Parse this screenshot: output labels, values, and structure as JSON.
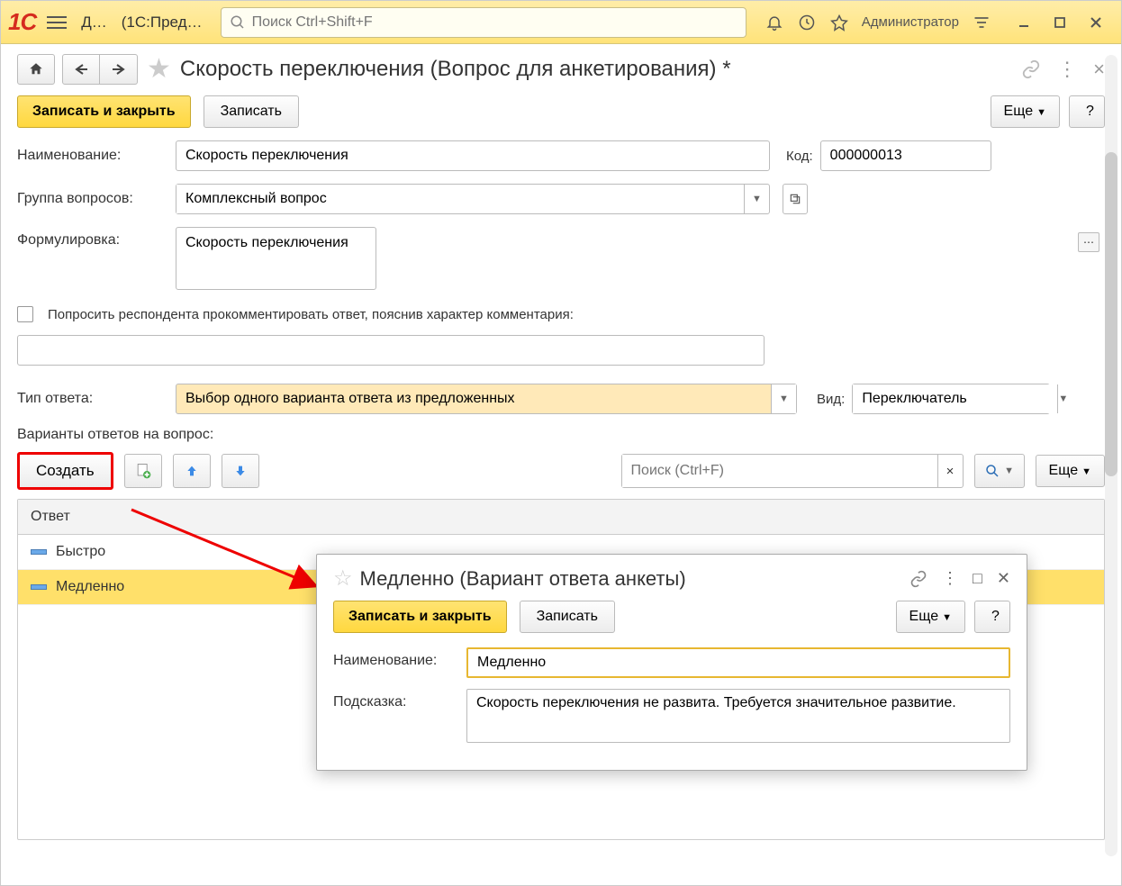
{
  "topbar": {
    "app_short": "Д…",
    "app_paren": "(1С:Пред…",
    "search_placeholder": "Поиск Ctrl+Shift+F",
    "user": "Администратор"
  },
  "page": {
    "title": "Скорость переключения (Вопрос для анкетирования) *"
  },
  "cmd": {
    "save_close": "Записать и закрыть",
    "save": "Записать",
    "more": "Еще",
    "help": "?"
  },
  "form": {
    "name_label": "Наименование:",
    "name_value": "Скорость переключения",
    "code_label": "Код:",
    "code_value": "000000013",
    "group_label": "Группа вопросов:",
    "group_value": "Комплексный вопрос",
    "wording_label": "Формулировка:",
    "wording_value": "Скорость переключения",
    "ask_comment": "Попросить респондента прокомментировать ответ, пояснив характер комментария:",
    "answer_type_label": "Тип ответа:",
    "answer_type_value": "Выбор одного варианта ответа из предложенных",
    "view_label": "Вид:",
    "view_value": "Переключатель",
    "variants_label": "Варианты ответов на вопрос:"
  },
  "ans_tb": {
    "create": "Создать",
    "search_placeholder": "Поиск (Ctrl+F)",
    "more": "Еще"
  },
  "table": {
    "header": "Ответ",
    "rows": [
      {
        "text": "Быстро"
      },
      {
        "text": "Медленно"
      }
    ]
  },
  "popup": {
    "title": "Медленно (Вариант ответа анкеты)",
    "save_close": "Записать и закрыть",
    "save": "Записать",
    "more": "Еще",
    "help": "?",
    "name_label": "Наименование:",
    "name_value": "Медленно",
    "hint_label": "Подсказка:",
    "hint_value": "Скорость переключения не развита. Требуется значительное развитие."
  }
}
